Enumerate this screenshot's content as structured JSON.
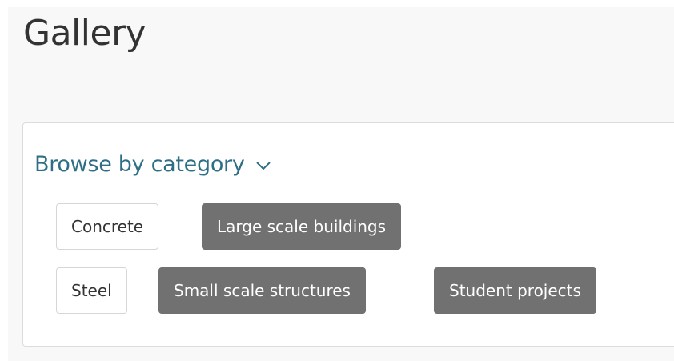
{
  "page": {
    "title": "Gallery"
  },
  "browse": {
    "label": "Browse by category",
    "icon": "chevron-down-icon",
    "color": "#2f6f86"
  },
  "categories": [
    {
      "label": "Concrete",
      "selected": false
    },
    {
      "label": "Large scale buildings",
      "selected": true
    },
    {
      "label": "Steel",
      "selected": false
    },
    {
      "label": "Small scale structures",
      "selected": true
    },
    {
      "label": "Student projects",
      "selected": true
    }
  ],
  "colors": {
    "selected_tag_bg": "#717171",
    "unselected_tag_bg": "#ffffff"
  }
}
